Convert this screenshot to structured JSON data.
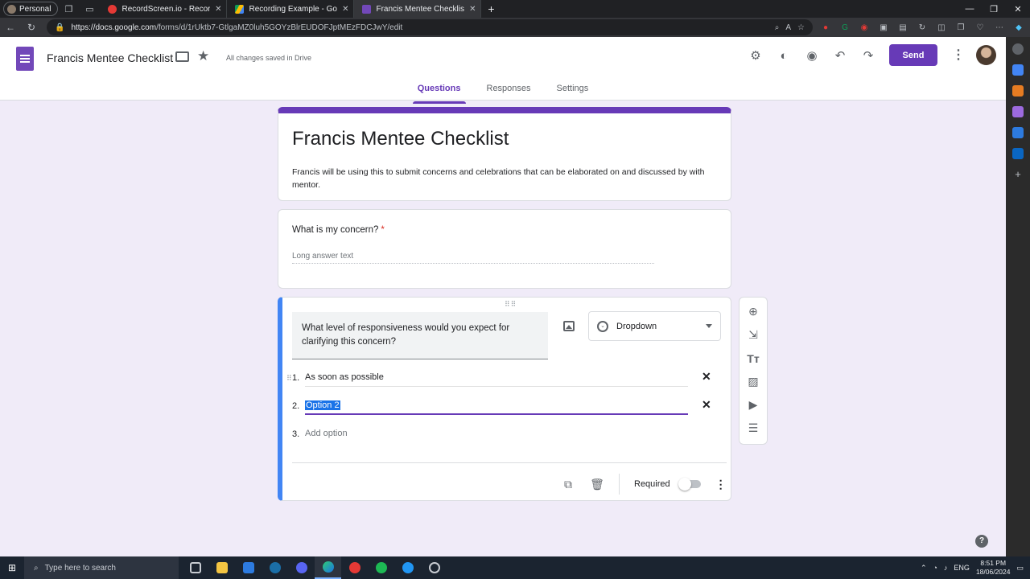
{
  "browser": {
    "profile": "Personal",
    "tabs": [
      {
        "title": "RecordScreen.io - Record y",
        "active": false,
        "color": "#e53935"
      },
      {
        "title": "Recording Example - Google Dri",
        "active": false,
        "color": "#fbbc04"
      },
      {
        "title": "Francis Mentee Checklist - Goog",
        "active": true,
        "color": "#7248b9"
      }
    ],
    "url_host": "https://docs.google.com",
    "url_path": "/forms/d/1rUktb7-GtlgaMZ0luh5GOYzBlrEUDOFJptMEzFDCJwY/edit"
  },
  "header": {
    "doc_title": "Francis Mentee Checklist",
    "saved_status": "All changes saved in Drive",
    "send_label": "Send",
    "icons": [
      "addons-icon",
      "palette-icon",
      "preview-eye-icon",
      "undo-icon",
      "redo-icon"
    ]
  },
  "form_tabs": [
    "Questions",
    "Responses",
    "Settings"
  ],
  "form": {
    "title": "Francis Mentee Checklist",
    "description": "Francis will be using this to submit concerns and celebrations that can be elaborated on and discussed by with mentor."
  },
  "q1": {
    "title": "What is my concern?",
    "required_mark": "*",
    "answer_placeholder": "Long answer text"
  },
  "q2": {
    "title": "What level of responsiveness would you expect for clarifying this concern?",
    "type": "Dropdown",
    "options": [
      {
        "num": "1.",
        "text": "As soon as possible"
      },
      {
        "num": "2.",
        "text": "Option 2"
      }
    ],
    "add_option": {
      "num": "3.",
      "text": "Add option"
    },
    "required_label": "Required",
    "required_on": false
  },
  "taskbar": {
    "search_placeholder": "Type here to search",
    "lang": "ENG",
    "time": "8:51 PM",
    "date": "18/06/2024"
  },
  "colors": {
    "accent": "#673ab7",
    "active_question_bar": "#4285f4"
  }
}
